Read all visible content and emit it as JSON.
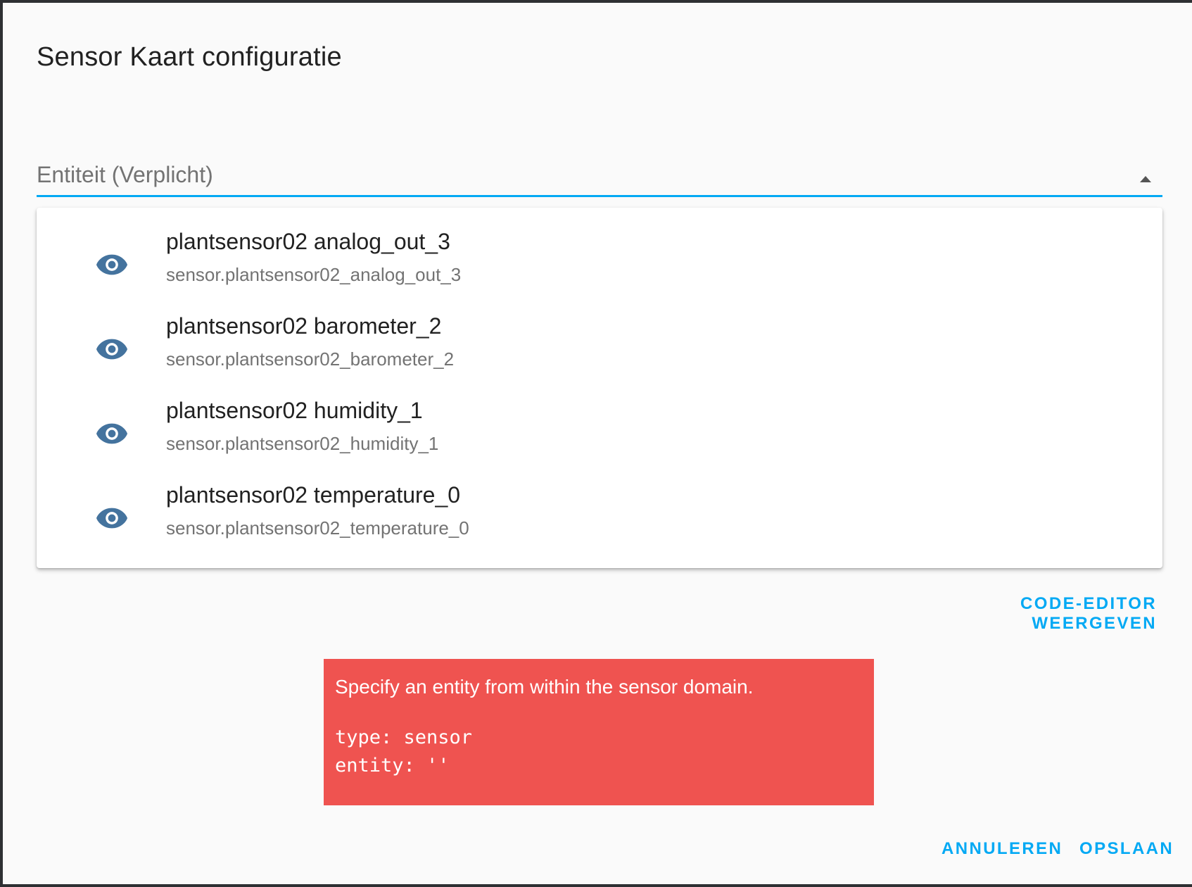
{
  "dialog": {
    "title": "Sensor Kaart configuratie"
  },
  "entity_field": {
    "label": "Entiteit (Verplicht)",
    "accent_color": "#03a9f4",
    "options": [
      {
        "name": "plantsensor02 analog_out_3",
        "entity_id": "sensor.plantsensor02_analog_out_3",
        "icon": "eye-icon"
      },
      {
        "name": "plantsensor02 barometer_2",
        "entity_id": "sensor.plantsensor02_barometer_2",
        "icon": "eye-icon"
      },
      {
        "name": "plantsensor02 humidity_1",
        "entity_id": "sensor.plantsensor02_humidity_1",
        "icon": "eye-icon"
      },
      {
        "name": "plantsensor02 temperature_0",
        "entity_id": "sensor.plantsensor02_temperature_0",
        "icon": "eye-icon"
      }
    ]
  },
  "code_editor_button": "CODE-EDITOR WEERGEVEN",
  "error": {
    "message": "Specify an entity from within the sensor domain.",
    "code": "type: sensor\nentity: ''",
    "background_color": "#ef5350"
  },
  "actions": {
    "cancel_label": "ANNULEREN",
    "save_label": "OPSLAAN"
  },
  "icon_color": "#44739e"
}
